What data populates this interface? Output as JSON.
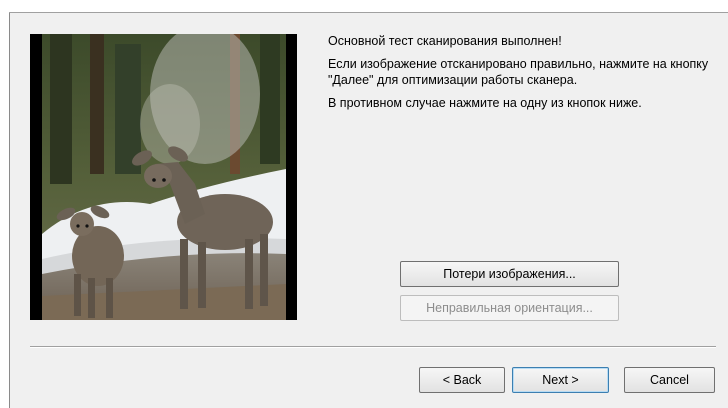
{
  "message": {
    "line1": "Основной тест сканирования выполнен!",
    "line2": "Если изображение отсканировано правильно, нажмите на кнопку \"Далее\" для оптимизации работы сканера.",
    "line3": "В противном случае нажмите на одну из кнопок ниже."
  },
  "buttons": {
    "image_loss": "Потери изображения...",
    "wrong_orientation": "Неправильная ориентация...",
    "back": "< Back",
    "next": "Next >",
    "cancel": "Cancel"
  },
  "colors": {
    "dialog_bg": "#f0f0f0",
    "default_button_border": "#3c7fb1",
    "disabled_text": "#8d8d8d"
  },
  "icons": {
    "scan_preview": "deer-photo"
  }
}
